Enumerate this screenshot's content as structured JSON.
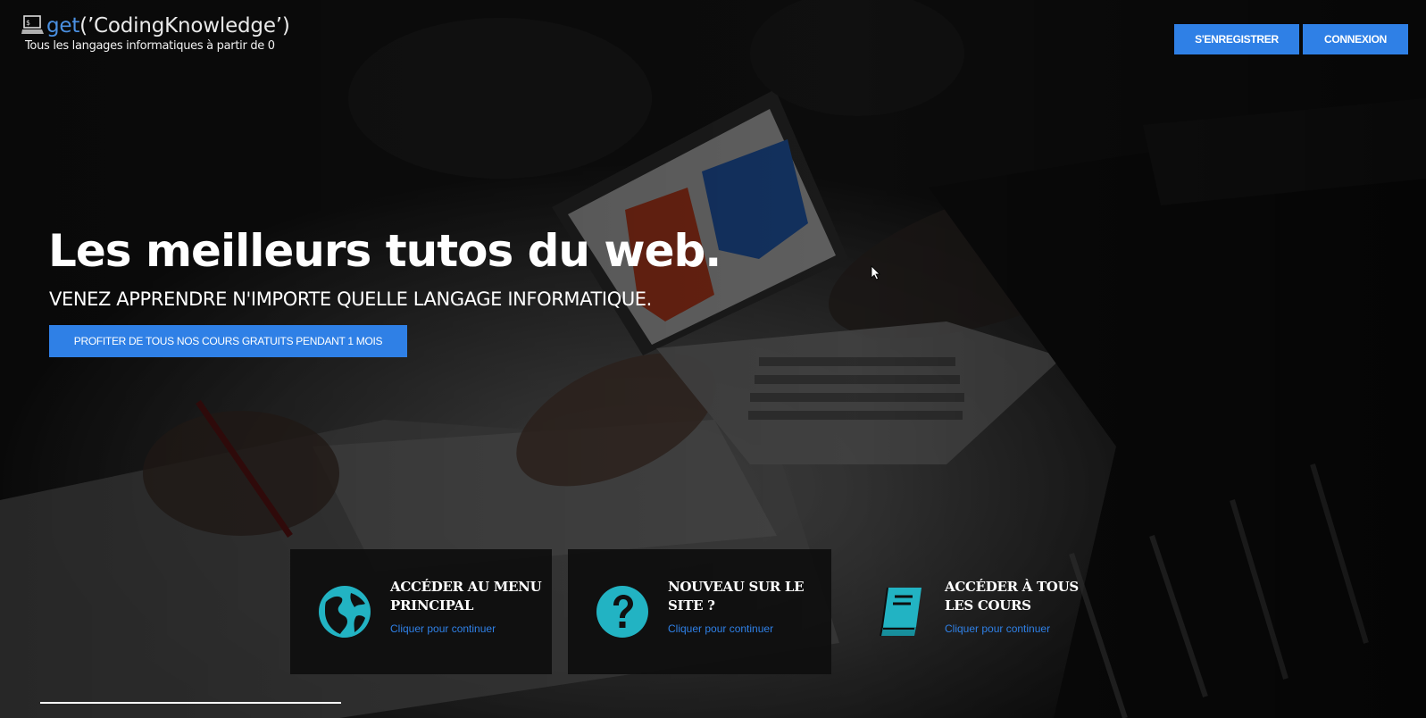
{
  "header": {
    "brand_prefix": "get",
    "brand_rest": "(’CodingKnowledge’)",
    "tagline": "Tous les langages informatiques à partir de 0",
    "register_label": "S'ENREGISTRER",
    "login_label": "CONNEXION"
  },
  "hero": {
    "title": "Les meilleurs tutos du web.",
    "subtitle": "VENEZ APPRENDRE N'IMPORTE QUELLE LANGAGE INFORMATIQUE.",
    "cta_label": "PROFITER DE TOUS NOS COURS GRATUITS PENDANT 1 MOIS"
  },
  "cards": [
    {
      "title": "ACCÉDER AU MENU PRINCIPAL",
      "link": "Cliquer pour continuer",
      "icon": "globe-icon"
    },
    {
      "title": "NOUVEAU SUR LE SITE ?",
      "link": "Cliquer pour continuer",
      "icon": "question-icon"
    },
    {
      "title": "ACCÉDER À TOUS LES COURS",
      "link": "Cliquer pour continuer",
      "icon": "book-icon"
    }
  ],
  "colors": {
    "accent": "#2f80e6",
    "icon_teal": "#22b3c3"
  }
}
